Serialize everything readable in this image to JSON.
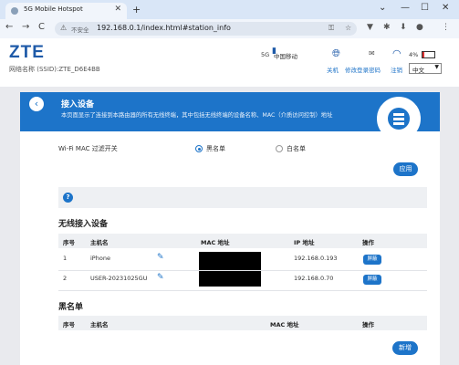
{
  "browser": {
    "tab_title": "5G Mobile Hotspot",
    "tab_close": "✕",
    "new_tab": "+",
    "window_controls": [
      "⌄",
      "—",
      "☐",
      "✕"
    ],
    "nav": [
      "←",
      "→",
      "C"
    ],
    "insecure_label": "不安全",
    "url": "192.168.0.1/index.html#station_info"
  },
  "header": {
    "logo": "ZTE",
    "ssid": "网络名称 (SSID):ZTE_D6E4BB",
    "network_type": "5G",
    "carrier": "中国移动",
    "battery": "4%",
    "links": [
      "关机",
      "修改登录密码",
      "注销"
    ],
    "language": "中文"
  },
  "panel": {
    "title": "接入设备",
    "description": "本页面显示了连接到本路由器的所有无线终端，其中包括无线终端的设备名称、MAC（介质访问控制）地址"
  },
  "filter": {
    "label": "Wi-Fi MAC 过滤开关",
    "options": [
      "黑名单",
      "白名单"
    ],
    "selected": "黑名单",
    "apply": "应用"
  },
  "help": {
    "icon": "?"
  },
  "wireless": {
    "title": "无线接入设备",
    "columns": [
      "序号",
      "主机名",
      "MAC 地址",
      "IP 地址",
      "操作"
    ],
    "rows": [
      {
        "no": "1",
        "host": "iPhone",
        "ip": "192.168.0.193",
        "action": "屏蔽"
      },
      {
        "no": "2",
        "host": "USER-20231025GU",
        "ip": "192.168.0.70",
        "action": "屏蔽"
      }
    ]
  },
  "blacklist": {
    "title": "黑名单",
    "columns": [
      "序号",
      "主机名",
      "MAC 地址",
      "操作"
    ],
    "add": "新增"
  }
}
